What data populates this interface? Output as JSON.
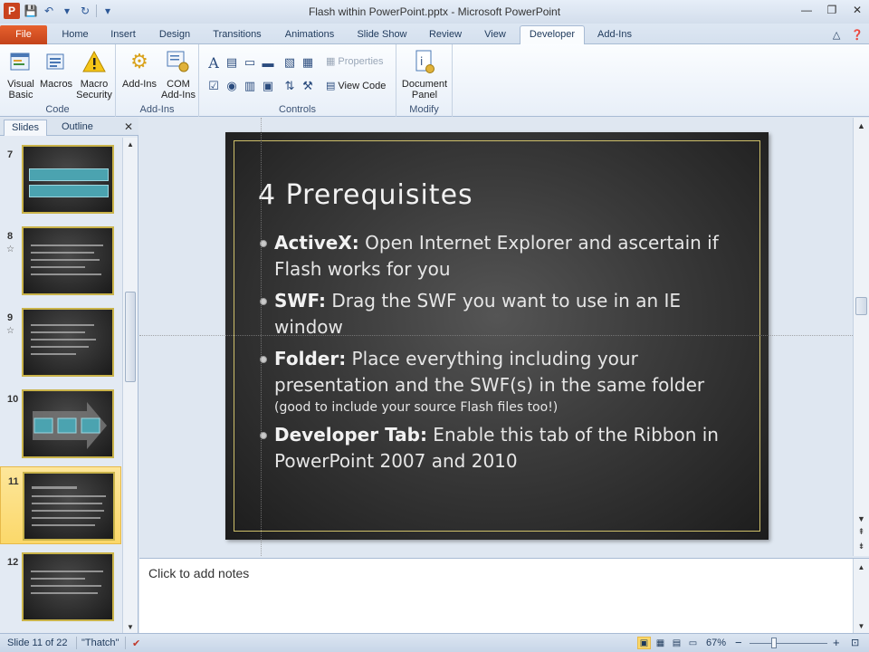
{
  "window": {
    "title": "Flash within PowerPoint.pptx - Microsoft PowerPoint",
    "minimize": "—",
    "restore": "❐",
    "close": "✕"
  },
  "qat": {
    "logo": "P",
    "save": "💾",
    "undo": "↶",
    "redo": "↻"
  },
  "tabs": [
    {
      "label": "File"
    },
    {
      "label": "Home"
    },
    {
      "label": "Insert"
    },
    {
      "label": "Design"
    },
    {
      "label": "Transitions"
    },
    {
      "label": "Animations"
    },
    {
      "label": "Slide Show"
    },
    {
      "label": "Review"
    },
    {
      "label": "View"
    },
    {
      "label": "Developer"
    },
    {
      "label": "Add-Ins"
    }
  ],
  "ribbon": {
    "code": {
      "label": "Code",
      "visual_basic": "Visual\nBasic",
      "macros": "Macros",
      "macro_security": "Macro\nSecurity"
    },
    "addins": {
      "label": "Add-Ins",
      "addins_btn": "Add-Ins",
      "com_addins": "COM\nAdd-Ins"
    },
    "controls": {
      "label": "Controls",
      "properties": "Properties",
      "view_code": "View Code"
    },
    "modify": {
      "label": "Modify",
      "document_panel": "Document\nPanel"
    }
  },
  "panel": {
    "tab_slides": "Slides",
    "tab_outline": "Outline",
    "close": "✕",
    "thumbs": [
      {
        "num": "7",
        "star": ""
      },
      {
        "num": "8",
        "star": "☆"
      },
      {
        "num": "9",
        "star": "☆"
      },
      {
        "num": "10",
        "star": ""
      },
      {
        "num": "11",
        "star": ""
      },
      {
        "num": "12",
        "star": ""
      }
    ]
  },
  "slide": {
    "title": "4 Prerequisites",
    "bullets": [
      {
        "head": "ActiveX:",
        "text": " Open Internet Explorer and ascertain if Flash works for you",
        "small": ""
      },
      {
        "head": "SWF:",
        "text": " Drag the SWF you want to use in an IE window",
        "small": ""
      },
      {
        "head": "Folder:",
        "text": " Place everything including your presentation and the SWF(s) in the same folder",
        "small": "(good to include your source Flash files too!)"
      },
      {
        "head": "Developer Tab:",
        "text": " Enable this tab of the Ribbon in PowerPoint 2007 and 2010",
        "small": ""
      }
    ]
  },
  "notes": {
    "placeholder": "Click to add notes"
  },
  "status": {
    "slide_count": "Slide 11 of 22",
    "theme": "\"Thatch\"",
    "zoom": "67%",
    "minus": "−",
    "plus": "+"
  }
}
